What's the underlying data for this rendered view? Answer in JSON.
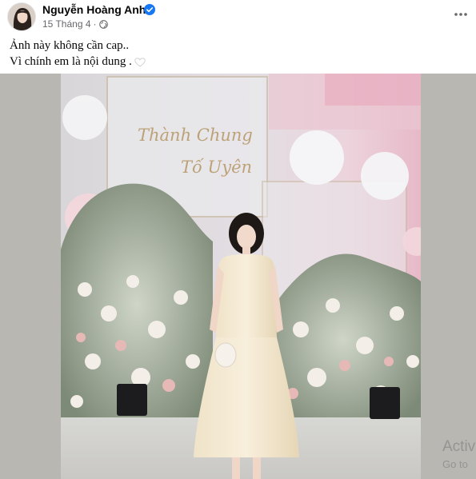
{
  "post": {
    "author_name": "Nguyễn Hoàng Anh",
    "date": "15 Tháng 4",
    "separator": "·",
    "caption_lines": [
      "Ảnh này không cần cap..",
      "Vì chính em là nội dung ."
    ]
  },
  "photo": {
    "sign_line1": "Thành Chung",
    "sign_line2": "Tố Uyên"
  },
  "watermark": {
    "line1": "Activ",
    "line2": "Go to"
  },
  "icons": {
    "verified": "verified-badge-icon",
    "audience": "globe-icon",
    "more": "more-options-icon",
    "heart": "white-heart-emoji"
  },
  "colors": {
    "verified_blue": "#1877f2",
    "meta_gray": "#65676b",
    "frame_gray": "#b9b7b1"
  }
}
